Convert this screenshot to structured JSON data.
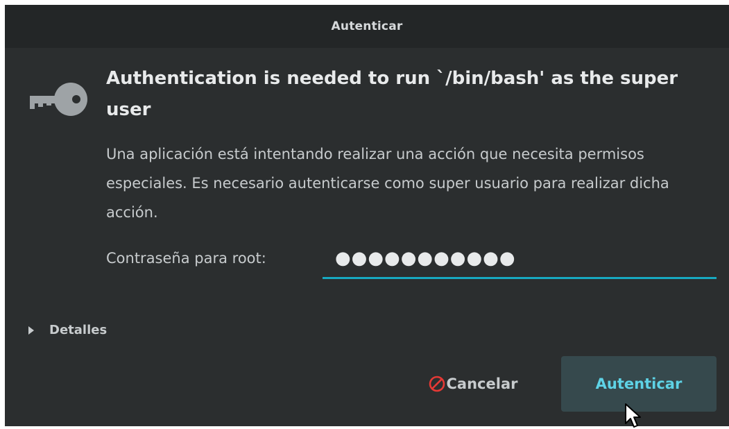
{
  "window": {
    "title": "Autenticar"
  },
  "dialog": {
    "heading": "Authentication is needed to run `/bin/bash' as the super user",
    "message": "Una aplicación está intentando realizar una acción que necesita permisos especiales. Es necesario autenticarse como super usuario para realizar dicha acción.",
    "password_label": "Contraseña para root:",
    "password_value": "●●●●●●●●●●●",
    "details_label": "Detalles",
    "cancel_label": "Cancelar",
    "authenticate_label": "Autenticar"
  },
  "icons": {
    "dialog_icon": "key-icon",
    "details_toggle": "triangle-right-icon",
    "cancel": "forbidden-icon",
    "pointer": "arrow-cursor-icon"
  },
  "colors": {
    "dialog_background": "#2b2e2f",
    "titlebar_background": "#232627",
    "accent": "#17a9c1",
    "cancel_icon": "#e53935",
    "primary_button_background": "#36494d",
    "primary_button_text": "#5ed3e6"
  }
}
